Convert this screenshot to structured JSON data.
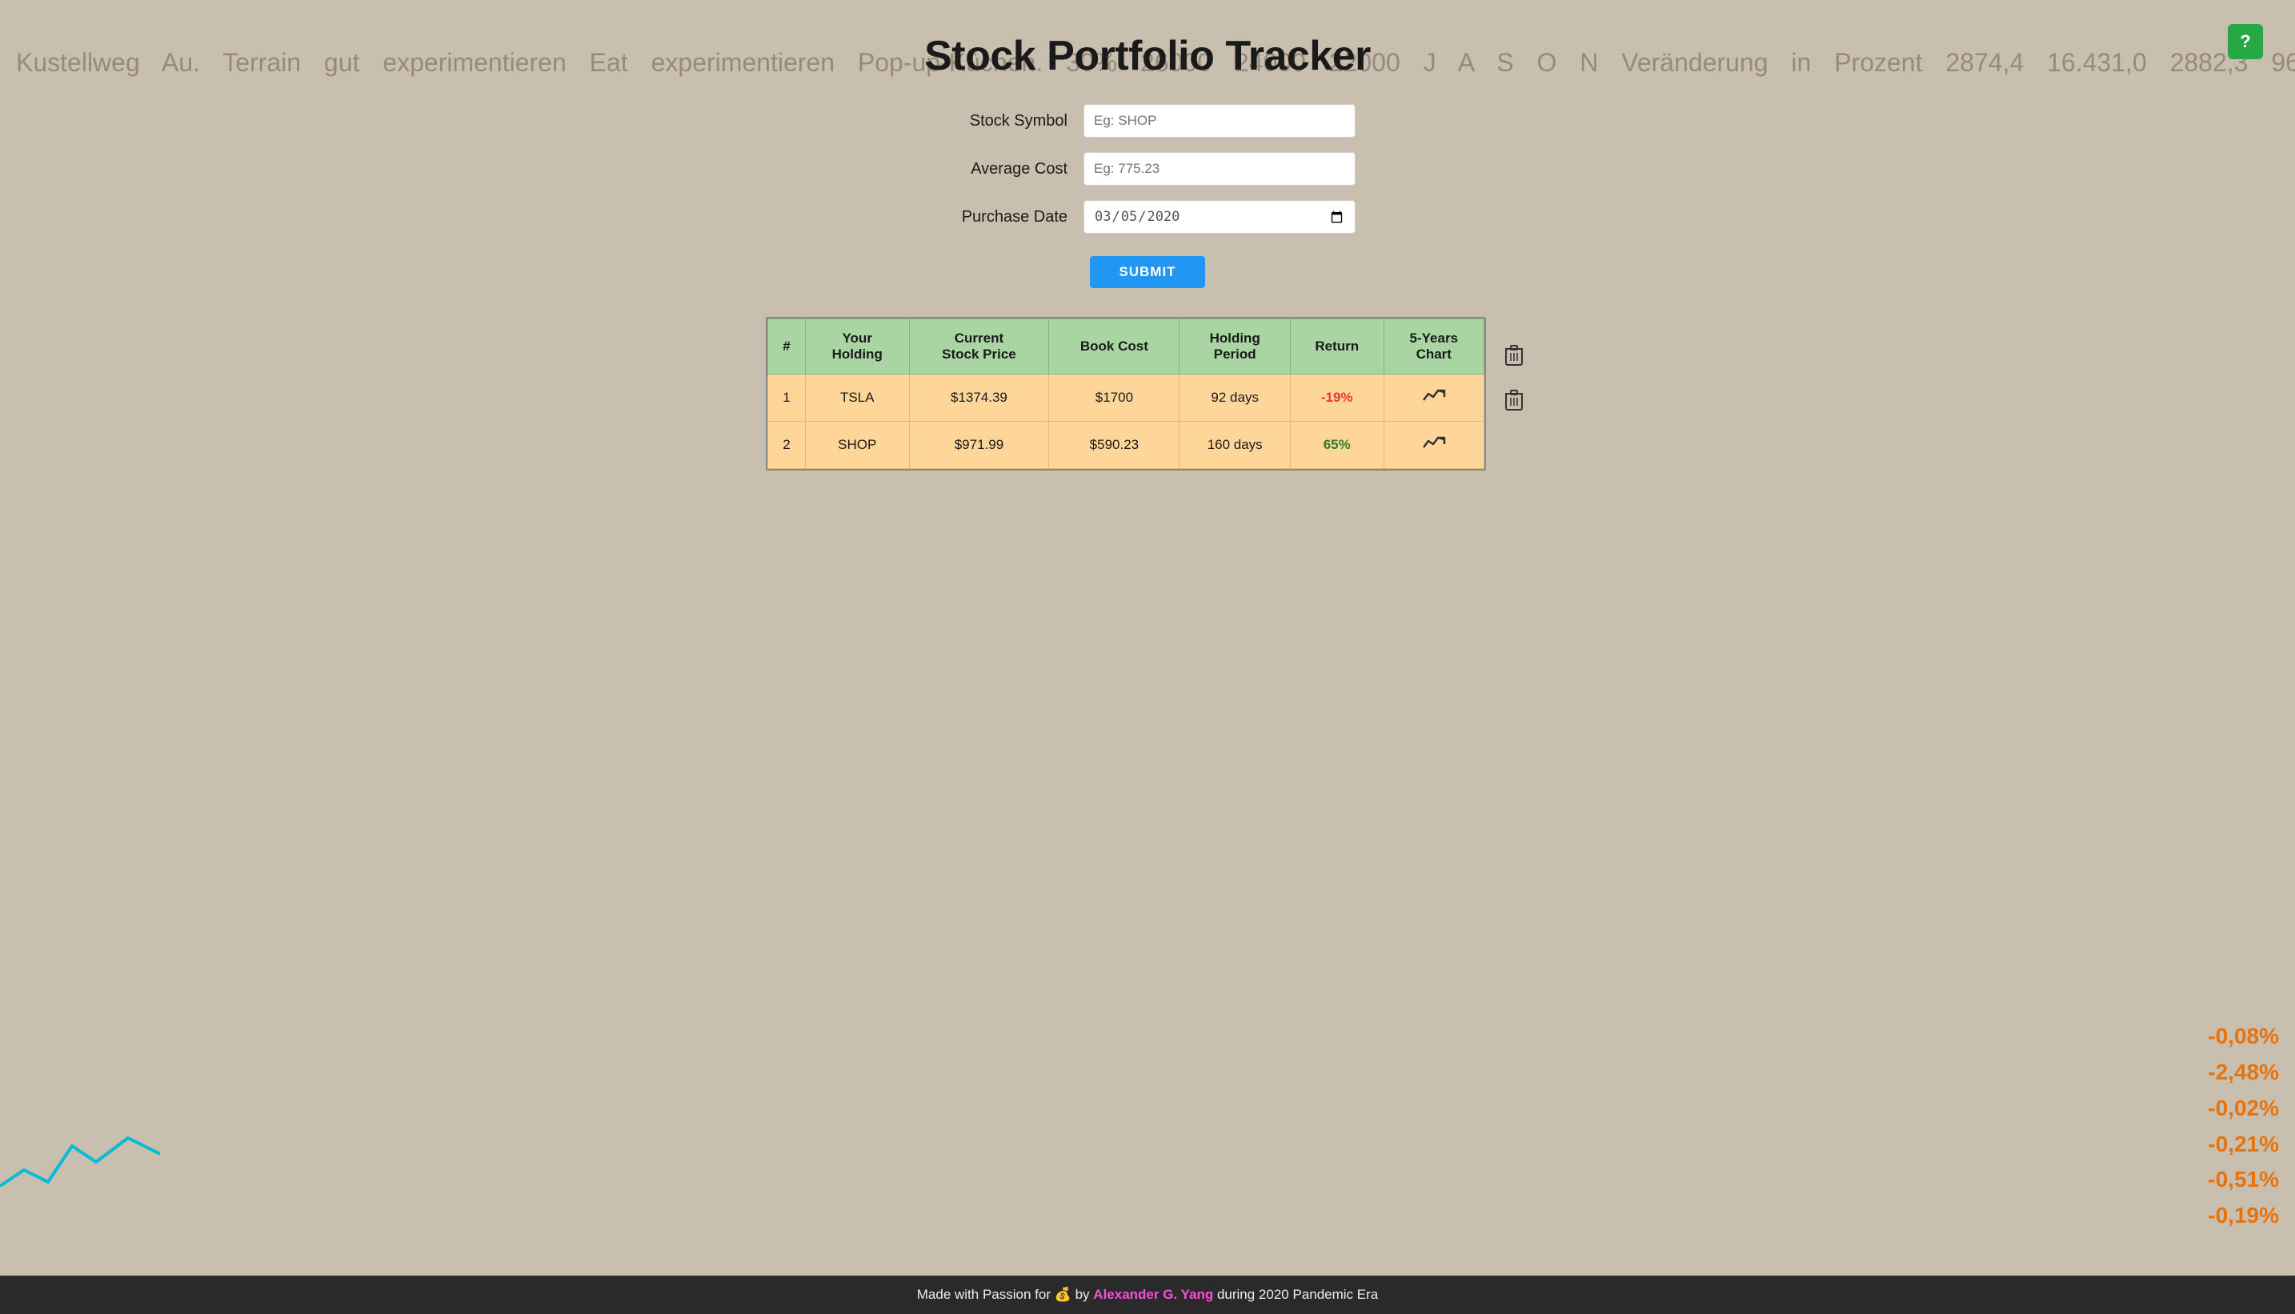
{
  "page": {
    "title": "Stock Portfolio Tracker"
  },
  "help_button": {
    "label": "?"
  },
  "form": {
    "stock_symbol_label": "Stock Symbol",
    "stock_symbol_placeholder": "Eg: SHOP",
    "average_cost_label": "Average Cost",
    "average_cost_placeholder": "Eg: 775.23",
    "purchase_date_label": "Purchase Date",
    "purchase_date_value": "2020-03-05",
    "submit_label": "SUBMIT"
  },
  "table": {
    "columns": [
      "#",
      "Your Holding",
      "Current Stock Price",
      "Book Cost",
      "Holding Period",
      "Return",
      "5-Years Chart"
    ],
    "rows": [
      {
        "index": "1",
        "holding": "TSLA",
        "current_price": "$1374.39",
        "book_cost": "$1700",
        "holding_period": "92 days",
        "return_value": "-19%",
        "return_type": "negative"
      },
      {
        "index": "2",
        "holding": "SHOP",
        "current_price": "$971.99",
        "book_cost": "$590.23",
        "holding_period": "160 days",
        "return_value": "65%",
        "return_type": "positive"
      }
    ]
  },
  "footer": {
    "text_before": "Made with Passion for 💰 by ",
    "author": "Alexander G. Yang",
    "text_after": " during 2020 Pandemic Era"
  },
  "bg": {
    "orange_numbers": "-0,08%\n-2,48%\n-0,02%\n-0,21%\n-0,51%\n-0,19%"
  }
}
